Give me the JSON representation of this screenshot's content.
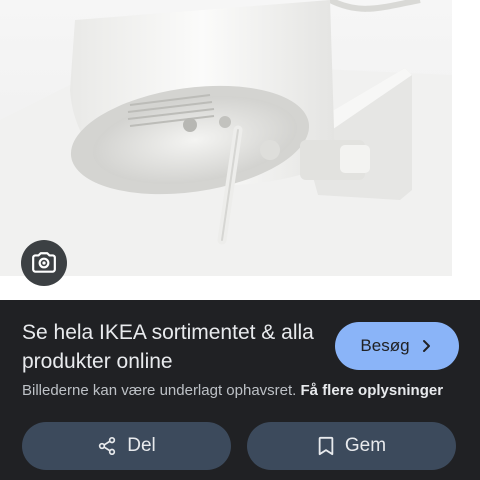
{
  "product": {
    "title": "Se hela IKEA sortimentet & alla produkter online",
    "visit_label": "Besøg",
    "copyright_text": "Billederne kan være underlagt ophavsret.",
    "more_info_label": "Få flere oplysninger"
  },
  "actions": {
    "share_label": "Del",
    "save_label": "Gem"
  },
  "icons": {
    "lens": "camera-search-icon",
    "visit": "chevron-right-icon",
    "share": "share-icon",
    "save": "bookmark-icon"
  },
  "colors": {
    "panel_background": "#202124",
    "primary_button": "#8ab4f8",
    "secondary_button": "#3c4a5c",
    "text_primary": "#e8eaed",
    "text_secondary": "#bdc1c6"
  }
}
